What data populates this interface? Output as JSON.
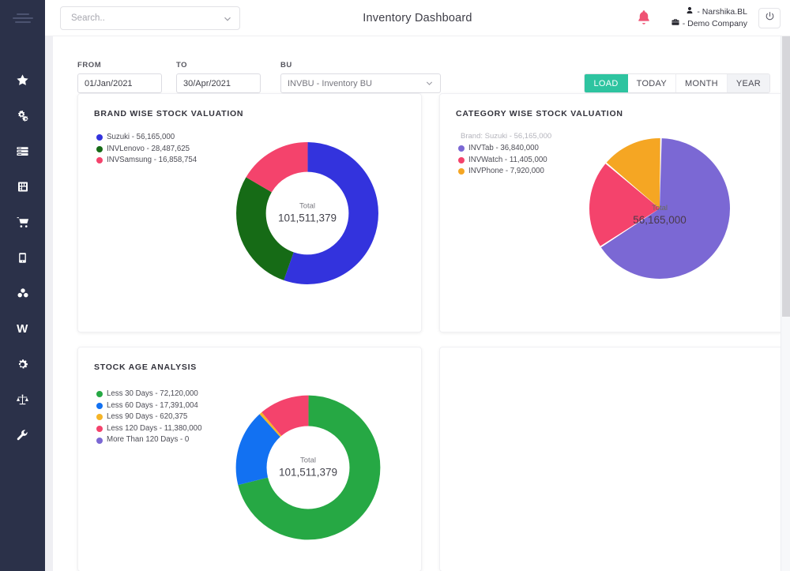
{
  "topbar": {
    "search_placeholder": "Search..",
    "search_value": "",
    "app_title": "Inventory Dashboard",
    "user_name": "- Narshika.BL",
    "company_name": "- Demo Company",
    "bell_icon": "bell-icon",
    "power_icon": "power-icon",
    "user_icon": "user-icon",
    "briefcase_icon": "briefcase-icon"
  },
  "sidebar": {
    "menu_icon": "hamburger-icon",
    "items": [
      {
        "icon": "star-icon",
        "label": "Favourites"
      },
      {
        "icon": "cogs-icon",
        "label": "Configuration"
      },
      {
        "icon": "server-icon",
        "label": "Masters"
      },
      {
        "icon": "book-icon",
        "label": "Ledger"
      },
      {
        "icon": "cart-icon",
        "label": "Purchase"
      },
      {
        "icon": "tablet-icon",
        "label": "Inventory"
      },
      {
        "icon": "cubes-icon",
        "label": "Stock"
      },
      {
        "icon": "w-icon",
        "label": "W"
      },
      {
        "icon": "gear-icon",
        "label": "Settings"
      },
      {
        "icon": "balance-scale-icon",
        "label": "Reports"
      },
      {
        "icon": "wrench-icon",
        "label": "Tools"
      }
    ]
  },
  "filters": {
    "from_label": "FROM",
    "from_value": "01/Jan/2021",
    "to_label": "TO",
    "to_value": "30/Apr/2021",
    "bu_label": "BU",
    "bu_value": "INVBU - Inventory BU",
    "chevron_icon": "chevron-down-icon",
    "buttons": [
      {
        "label": "LOAD",
        "active": true
      },
      {
        "label": "TODAY",
        "active": false
      },
      {
        "label": "MONTH",
        "active": false
      },
      {
        "label": "YEAR",
        "active": false
      }
    ],
    "accent_color": "#2ec4a0"
  },
  "cards": {
    "brand": {
      "title": "BRAND WISE STOCK VALUATION"
    },
    "category": {
      "title": "CATEGORY WISE STOCK VALUATION",
      "subtitle": "Brand: Suzuki - 56,165,000"
    },
    "stock_age": {
      "title": "STOCK AGE ANALYSIS"
    }
  },
  "chart_data": [
    {
      "type": "pie",
      "variant": "donut",
      "title": "BRAND WISE STOCK VALUATION",
      "center_caption": "Total",
      "center_value": "101,511,379",
      "total": 101511379,
      "legend_position": "top-left",
      "labels": [
        "Suzuki",
        "INVLenovo",
        "INVSamsung"
      ],
      "values": [
        56165000,
        28487625,
        16858754
      ],
      "value_labels": [
        "56,165,000",
        "28,487,625",
        "16,858,754"
      ],
      "legend_entries": [
        "Suzuki - 56,165,000",
        "INVLenovo - 28,487,625",
        "INVSamsung - 16,858,754"
      ],
      "colors": [
        "#3333dd",
        "#166b16",
        "#f4436c"
      ]
    },
    {
      "type": "pie",
      "variant": "pie",
      "title": "CATEGORY WISE STOCK VALUATION",
      "subtitle": "Brand: Suzuki - 56,165,000",
      "center_caption": "Total",
      "center_value": "56,165,000",
      "total": 56165000,
      "legend_position": "top-left",
      "labels": [
        "INVTab",
        "INVWatch",
        "INVPhone"
      ],
      "values": [
        36840000,
        11405000,
        7920000
      ],
      "value_labels": [
        "36,840,000",
        "11,405,000",
        "7,920,000"
      ],
      "legend_entries": [
        "INVTab - 36,840,000",
        "INVWatch - 11,405,000",
        "INVPhone - 7,920,000"
      ],
      "colors": [
        "#7b68d4",
        "#f4436c",
        "#f5a623"
      ]
    },
    {
      "type": "pie",
      "variant": "donut",
      "title": "STOCK AGE ANALYSIS",
      "center_caption": "Total",
      "center_value": "101,511,379",
      "total": 101511379,
      "legend_position": "top-left",
      "labels": [
        "Less 30 Days",
        "Less 60 Days",
        "Less 90 Days",
        "Less 120 Days",
        "More Than 120 Days"
      ],
      "values": [
        72120000,
        17391004,
        620375,
        11380000,
        0
      ],
      "value_labels": [
        "72,120,000",
        "17,391,004",
        "620,375",
        "11,380,000",
        "0"
      ],
      "legend_entries": [
        "Less 30 Days - 72,120,000",
        "Less 60 Days - 17,391,004",
        "Less 90 Days - 620,375",
        "Less 120 Days - 11,380,000",
        "More Than 120 Days - 0"
      ],
      "colors": [
        "#26a844",
        "#1271f2",
        "#f5b427",
        "#f4436c",
        "#7b68d4"
      ]
    }
  ]
}
